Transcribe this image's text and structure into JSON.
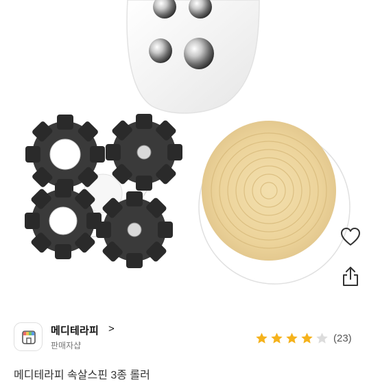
{
  "seller": {
    "name": "메디테라피",
    "chevron": ">",
    "subtitle": "판매자샵"
  },
  "rating": {
    "stars": 4,
    "max_stars": 5,
    "review_count": "(23)",
    "star_color": "#f5b21b",
    "empty_star_color": "#dcdcdc"
  },
  "product": {
    "title": "메디테라피 속살스핀 3종 롤러"
  },
  "icons": {
    "like": "heart-icon",
    "share": "share-icon",
    "store": "store-icon"
  }
}
